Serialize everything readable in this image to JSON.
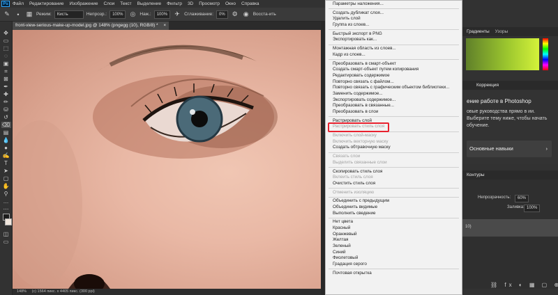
{
  "menubar": {
    "logo": "Ps",
    "items": [
      "Файл",
      "Редактирование",
      "Изображение",
      "Слои",
      "Текст",
      "Выделение",
      "Фильтр",
      "3D",
      "Просмотр",
      "Окно",
      "Справка"
    ]
  },
  "options": {
    "mode_label": "Режим:",
    "mode_value": "Кисть",
    "opacity_label": "Непрозр.:",
    "opacity_value": "100%",
    "flow_label": "Наж.:",
    "flow_value": "100%",
    "smoothing_label": "Сглаживание:",
    "smoothing_value": "0%",
    "restore_label": "Восста-ить"
  },
  "document": {
    "tab_title": "front-view-serious-make-up-model.jpg @ 148% (pngegg (10), RGB/8) *",
    "zoom": "148%",
    "status": "(c) 1564 пикс. x 4405 пикс. (300 ppi)"
  },
  "context_menu": {
    "groups": [
      [
        {
          "label": "Параметры наложения...",
          "disabled": false
        }
      ],
      [
        {
          "label": "Создать дубликат слоя...",
          "disabled": false
        },
        {
          "label": "Удалить слой",
          "disabled": false
        },
        {
          "label": "Группа из слоев...",
          "disabled": false
        }
      ],
      [
        {
          "label": "Быстрый экспорт в PNG",
          "disabled": false
        },
        {
          "label": "Экспортировать как...",
          "disabled": false
        }
      ],
      [
        {
          "label": "Монтажная область из слоев...",
          "disabled": false
        },
        {
          "label": "Кадр из слоев...",
          "disabled": false
        }
      ],
      [
        {
          "label": "Преобразовать в смарт-объект",
          "disabled": false
        },
        {
          "label": "Создать смарт-объект путем копирования",
          "disabled": false
        },
        {
          "label": "Редактировать содержимое",
          "disabled": false
        },
        {
          "label": "Повторно связать с файлом...",
          "disabled": false
        },
        {
          "label": "Повторно связать с графическим объектом библиотеки...",
          "disabled": false
        },
        {
          "label": "Заменить содержимое...",
          "disabled": false
        },
        {
          "label": "Экспортировать содержимое...",
          "disabled": false
        },
        {
          "label": "Преобразовать в связанные...",
          "disabled": false
        },
        {
          "label": "Преобразовать в слои",
          "disabled": false
        }
      ],
      [
        {
          "label": "Растрировать слой",
          "disabled": false
        },
        {
          "label": "Растрировать стиль слоя",
          "disabled": true
        }
      ],
      [
        {
          "label": "Включить слой-маску",
          "disabled": true
        },
        {
          "label": "Включить векторную маску",
          "disabled": true
        },
        {
          "label": "Создать обтравочную маску",
          "disabled": false
        }
      ],
      [
        {
          "label": "Связать слои",
          "disabled": true
        },
        {
          "label": "Выделить связанные слои",
          "disabled": true
        }
      ],
      [
        {
          "label": "Скопировать стиль слоя",
          "disabled": false
        },
        {
          "label": "Вклеить стиль слоя",
          "disabled": true
        },
        {
          "label": "Очистить стиль слоя",
          "disabled": false
        }
      ],
      [
        {
          "label": "Отменить изоляцию",
          "disabled": true
        }
      ],
      [
        {
          "label": "Объединить с предыдущим",
          "disabled": false
        },
        {
          "label": "Объединить видимые",
          "disabled": false
        },
        {
          "label": "Выполнить сведение",
          "disabled": false
        }
      ],
      [
        {
          "label": "Нет цвета",
          "disabled": false
        },
        {
          "label": "Красный",
          "disabled": false
        },
        {
          "label": "Оранжевый",
          "disabled": false
        },
        {
          "label": "Желтая",
          "disabled": false
        },
        {
          "label": "Зеленый",
          "disabled": false
        },
        {
          "label": "Синий",
          "disabled": false
        },
        {
          "label": "Фиолетовый",
          "disabled": false
        },
        {
          "label": "Градация серого",
          "disabled": false
        }
      ],
      [
        {
          "label": "Почтовая открытка",
          "disabled": false
        }
      ]
    ],
    "highlight_color": "#e8212e"
  },
  "panels": {
    "color_tabs": [
      "Градиенты",
      "Узоры"
    ],
    "prop_tabs": [
      "Коррекция"
    ],
    "learn": {
      "title": "ение работе в Photoshop",
      "desc": "овые руководства прямо в ии. Выберите тему ниже, чтобы начать обучение.",
      "card": "Основные навыки",
      "card_chevron": "›"
    },
    "layers": {
      "tab": "Контуры",
      "opacity_label": "Непрозрачность:",
      "opacity_value": "60%",
      "fill_label": "Заливка:",
      "fill_value": "100%",
      "layer_name": "10)"
    }
  }
}
